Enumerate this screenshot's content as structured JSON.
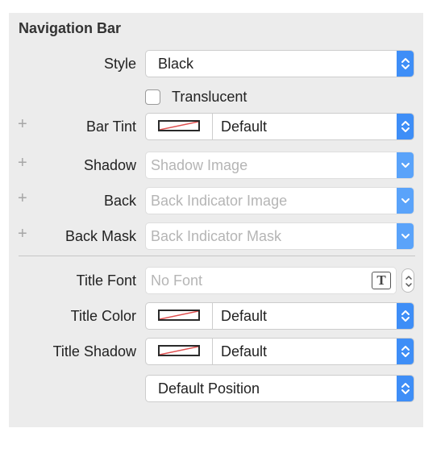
{
  "section": {
    "title": "Navigation Bar"
  },
  "style": {
    "label": "Style",
    "value": "Black"
  },
  "translucent": {
    "label": "Translucent",
    "checked": false
  },
  "bar_tint": {
    "label": "Bar Tint",
    "value": "Default"
  },
  "shadow": {
    "label": "Shadow",
    "placeholder": "Shadow Image"
  },
  "back": {
    "label": "Back",
    "placeholder": "Back Indicator Image"
  },
  "back_mask": {
    "label": "Back Mask",
    "placeholder": "Back Indicator Mask"
  },
  "title_font": {
    "label": "Title Font",
    "placeholder": "No Font",
    "icon_glyph": "T"
  },
  "title_color": {
    "label": "Title Color",
    "value": "Default"
  },
  "title_shadow": {
    "label": "Title Shadow",
    "value": "Default"
  },
  "position": {
    "value": "Default Position"
  },
  "add_symbol": "+",
  "icons": {
    "add": "plus-icon",
    "popup": "up-down-chevrons-icon",
    "combo": "chevron-down-icon",
    "font": "font-picker-icon",
    "color_swatch": "color-swatch-default-icon"
  },
  "colors": {
    "accent": "#3e8ef7",
    "panel": "#ececec",
    "swatch_slash": "#e05050"
  }
}
